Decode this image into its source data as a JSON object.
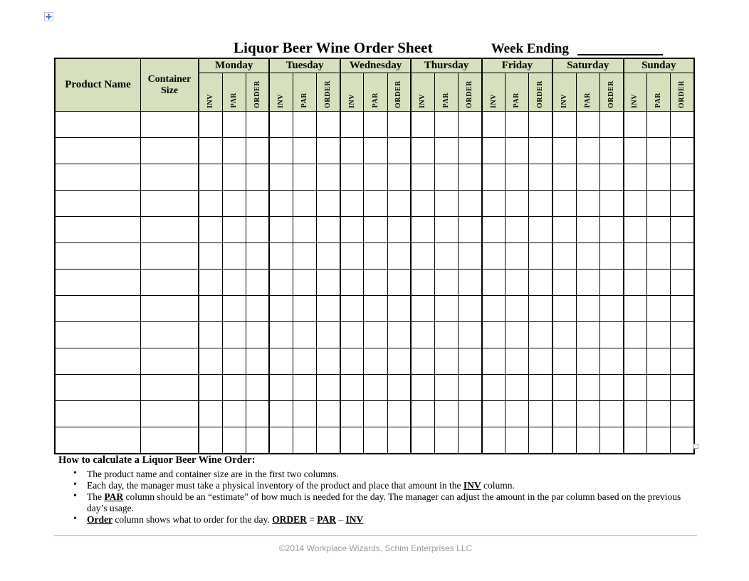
{
  "document": {
    "title": "Liquor Beer Wine Order Sheet",
    "week_ending_label": "Week Ending",
    "week_ending_value": ""
  },
  "icons": {
    "table_move_handle": "move-four-arrows-icon",
    "table_resize_handle": "resize-handle-icon"
  },
  "table": {
    "columns": {
      "product_name": "Product Name",
      "container_size": "Container Size",
      "container_size_line1": "Container",
      "container_size_line2": "Size"
    },
    "days": [
      {
        "label": "Monday",
        "sub": [
          "INV",
          "PAR",
          "ORDER"
        ]
      },
      {
        "label": "Tuesday",
        "sub": [
          "INV",
          "PAR",
          "ORDER"
        ]
      },
      {
        "label": "Wednesday",
        "sub": [
          "INV",
          "PAR",
          "ORDER"
        ]
      },
      {
        "label": "Thursday",
        "sub": [
          "INV",
          "PAR",
          "ORDER"
        ]
      },
      {
        "label": "Friday",
        "sub": [
          "INV",
          "PAR",
          "ORDER"
        ]
      },
      {
        "label": "Saturday",
        "sub": [
          "INV",
          "PAR",
          "ORDER"
        ]
      },
      {
        "label": "Sunday",
        "sub": [
          "INV",
          "PAR",
          "ORDER"
        ]
      }
    ],
    "body_row_count": 13,
    "body_rows": [
      {
        "product_name": "",
        "container_size": "",
        "cells": [
          "",
          "",
          "",
          "",
          "",
          "",
          "",
          "",
          "",
          "",
          "",
          "",
          "",
          "",
          "",
          "",
          "",
          "",
          "",
          "",
          ""
        ]
      },
      {
        "product_name": "",
        "container_size": "",
        "cells": [
          "",
          "",
          "",
          "",
          "",
          "",
          "",
          "",
          "",
          "",
          "",
          "",
          "",
          "",
          "",
          "",
          "",
          "",
          "",
          "",
          ""
        ]
      },
      {
        "product_name": "",
        "container_size": "",
        "cells": [
          "",
          "",
          "",
          "",
          "",
          "",
          "",
          "",
          "",
          "",
          "",
          "",
          "",
          "",
          "",
          "",
          "",
          "",
          "",
          "",
          ""
        ]
      },
      {
        "product_name": "",
        "container_size": "",
        "cells": [
          "",
          "",
          "",
          "",
          "",
          "",
          "",
          "",
          "",
          "",
          "",
          "",
          "",
          "",
          "",
          "",
          "",
          "",
          "",
          "",
          ""
        ]
      },
      {
        "product_name": "",
        "container_size": "",
        "cells": [
          "",
          "",
          "",
          "",
          "",
          "",
          "",
          "",
          "",
          "",
          "",
          "",
          "",
          "",
          "",
          "",
          "",
          "",
          "",
          "",
          ""
        ]
      },
      {
        "product_name": "",
        "container_size": "",
        "cells": [
          "",
          "",
          "",
          "",
          "",
          "",
          "",
          "",
          "",
          "",
          "",
          "",
          "",
          "",
          "",
          "",
          "",
          "",
          "",
          "",
          ""
        ]
      },
      {
        "product_name": "",
        "container_size": "",
        "cells": [
          "",
          "",
          "",
          "",
          "",
          "",
          "",
          "",
          "",
          "",
          "",
          "",
          "",
          "",
          "",
          "",
          "",
          "",
          "",
          "",
          ""
        ]
      },
      {
        "product_name": "",
        "container_size": "",
        "cells": [
          "",
          "",
          "",
          "",
          "",
          "",
          "",
          "",
          "",
          "",
          "",
          "",
          "",
          "",
          "",
          "",
          "",
          "",
          "",
          "",
          ""
        ]
      },
      {
        "product_name": "",
        "container_size": "",
        "cells": [
          "",
          "",
          "",
          "",
          "",
          "",
          "",
          "",
          "",
          "",
          "",
          "",
          "",
          "",
          "",
          "",
          "",
          "",
          "",
          "",
          ""
        ]
      },
      {
        "product_name": "",
        "container_size": "",
        "cells": [
          "",
          "",
          "",
          "",
          "",
          "",
          "",
          "",
          "",
          "",
          "",
          "",
          "",
          "",
          "",
          "",
          "",
          "",
          "",
          "",
          ""
        ]
      },
      {
        "product_name": "",
        "container_size": "",
        "cells": [
          "",
          "",
          "",
          "",
          "",
          "",
          "",
          "",
          "",
          "",
          "",
          "",
          "",
          "",
          "",
          "",
          "",
          "",
          "",
          "",
          ""
        ]
      },
      {
        "product_name": "",
        "container_size": "",
        "cells": [
          "",
          "",
          "",
          "",
          "",
          "",
          "",
          "",
          "",
          "",
          "",
          "",
          "",
          "",
          "",
          "",
          "",
          "",
          "",
          "",
          ""
        ]
      },
      {
        "product_name": "",
        "container_size": "",
        "cells": [
          "",
          "",
          "",
          "",
          "",
          "",
          "",
          "",
          "",
          "",
          "",
          "",
          "",
          "",
          "",
          "",
          "",
          "",
          "",
          "",
          ""
        ]
      }
    ]
  },
  "instructions": {
    "heading": "How to calculate a Liquor Beer Wine Order:",
    "bullets": [
      {
        "parts": [
          {
            "text": "The product name and container size are in the first two columns.",
            "style": "normal"
          }
        ]
      },
      {
        "parts": [
          {
            "text": "Each day, the manager must take a physical inventory of the product and place that amount in the ",
            "style": "normal"
          },
          {
            "text": "INV",
            "style": "bold-underline"
          },
          {
            "text": " column.",
            "style": "normal"
          }
        ]
      },
      {
        "parts": [
          {
            "text": "The ",
            "style": "normal"
          },
          {
            "text": "PAR",
            "style": "bold-underline"
          },
          {
            "text": " column should be an “estimate” of how much is needed for the day. The manager can adjust the amount in the par column based on the previous day’s usage.",
            "style": "normal"
          }
        ]
      },
      {
        "parts": [
          {
            "text": "Order",
            "style": "bold-underline"
          },
          {
            "text": " column shows what to order for the day. ",
            "style": "normal"
          },
          {
            "text": "ORDER",
            "style": "bold-underline"
          },
          {
            "text": " = ",
            "style": "normal"
          },
          {
            "text": "PAR",
            "style": "bold-underline"
          },
          {
            "text": " – ",
            "style": "normal"
          },
          {
            "text": "INV",
            "style": "bold-underline"
          }
        ]
      }
    ]
  },
  "footer": {
    "copyright": "©2014 Workplace Wizards, Schim Enterprises LLC"
  },
  "colors": {
    "header_green": "#d6e0bd",
    "border_black": "#000000",
    "footer_gray": "#9b9b9b",
    "rule_gray": "#a6a6a6",
    "handle_blue": "#3b6ab5"
  }
}
